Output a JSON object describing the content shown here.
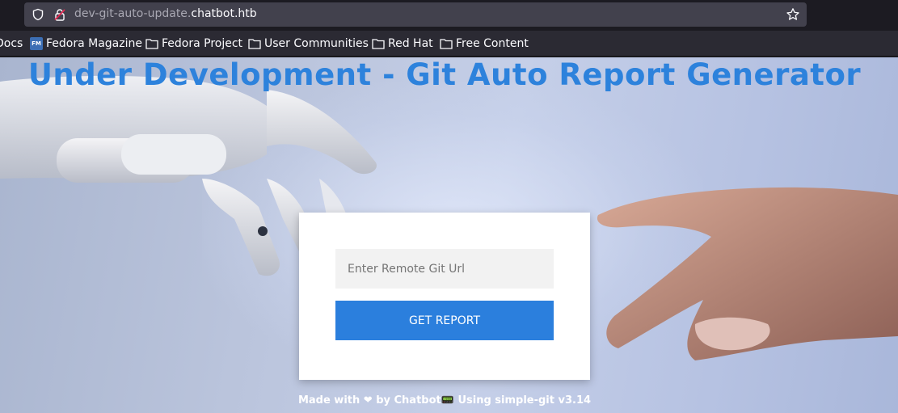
{
  "browser": {
    "url_subdomain": "dev-git-auto-update.",
    "url_domain": "chatbot.htb",
    "bookmarks": [
      {
        "label": "Docs",
        "icon": "none"
      },
      {
        "label": "Fedora Magazine",
        "icon": "fedora-magazine-icon"
      },
      {
        "label": "Fedora Project",
        "icon": "folder-icon"
      },
      {
        "label": "User Communities",
        "icon": "folder-icon"
      },
      {
        "label": "Red Hat",
        "icon": "folder-icon"
      },
      {
        "label": "Free Content",
        "icon": "folder-icon"
      }
    ]
  },
  "page": {
    "title": "Under Development - Git Auto Report Generator",
    "input_placeholder": "Enter Remote Git Url",
    "button_label": "GET REPORT",
    "footer_text": "Made with ❤ by Chatbot📟 Using simple-git v3.14"
  },
  "colors": {
    "title": "#2d82dc",
    "button": "#2b7fdd",
    "card": "#ffffff"
  }
}
